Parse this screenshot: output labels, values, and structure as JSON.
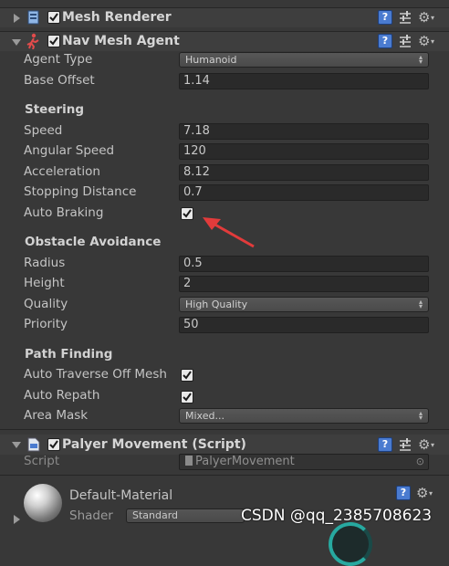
{
  "components": {
    "mesh_renderer": {
      "title": "Mesh Renderer",
      "enabled": true,
      "icon": "mesh-renderer-icon"
    },
    "nav_mesh_agent": {
      "title": "Nav Mesh Agent",
      "enabled": true,
      "icon": "nav-agent-icon",
      "agent_type": {
        "label": "Agent Type",
        "value": "Humanoid"
      },
      "base_offset": {
        "label": "Base Offset",
        "value": "1.14"
      },
      "steering": {
        "heading": "Steering",
        "speed": {
          "label": "Speed",
          "value": "7.18"
        },
        "angular_speed": {
          "label": "Angular Speed",
          "value": "120"
        },
        "acceleration": {
          "label": "Acceleration",
          "value": "8.12"
        },
        "stopping_distance": {
          "label": "Stopping Distance",
          "value": "0.7"
        },
        "auto_braking": {
          "label": "Auto Braking",
          "checked": true
        }
      },
      "obstacle_avoidance": {
        "heading": "Obstacle Avoidance",
        "radius": {
          "label": "Radius",
          "value": "0.5"
        },
        "height": {
          "label": "Height",
          "value": "2"
        },
        "quality": {
          "label": "Quality",
          "value": "High Quality"
        },
        "priority": {
          "label": "Priority",
          "value": "50"
        }
      },
      "path_finding": {
        "heading": "Path Finding",
        "auto_traverse": {
          "label": "Auto Traverse Off Mesh",
          "checked": true
        },
        "auto_repath": {
          "label": "Auto Repath",
          "checked": true
        },
        "area_mask": {
          "label": "Area Mask",
          "value": "Mixed..."
        }
      }
    },
    "player_movement": {
      "title": "Palyer Movement (Script)",
      "enabled": true,
      "script": {
        "label": "Script",
        "value": "PalyerMovement"
      }
    },
    "material": {
      "name": "Default-Material",
      "shader_label": "Shader",
      "shader_value": "Standard"
    }
  },
  "watermark": "CSDN @qq_2385708623",
  "colors": {
    "annotation_arrow": "#e23b3b",
    "book_icon": "#4a7bd0",
    "checkbox": "#e8e8e8"
  }
}
